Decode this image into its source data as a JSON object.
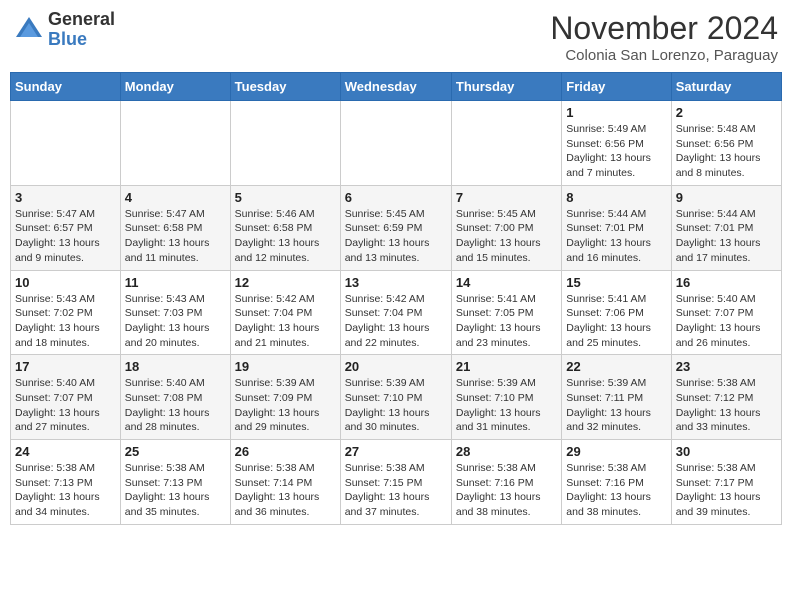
{
  "header": {
    "logo_general": "General",
    "logo_blue": "Blue",
    "month_title": "November 2024",
    "subtitle": "Colonia San Lorenzo, Paraguay"
  },
  "weekdays": [
    "Sunday",
    "Monday",
    "Tuesday",
    "Wednesday",
    "Thursday",
    "Friday",
    "Saturday"
  ],
  "weeks": [
    [
      {
        "day": "",
        "info": ""
      },
      {
        "day": "",
        "info": ""
      },
      {
        "day": "",
        "info": ""
      },
      {
        "day": "",
        "info": ""
      },
      {
        "day": "",
        "info": ""
      },
      {
        "day": "1",
        "info": "Sunrise: 5:49 AM\nSunset: 6:56 PM\nDaylight: 13 hours\nand 7 minutes."
      },
      {
        "day": "2",
        "info": "Sunrise: 5:48 AM\nSunset: 6:56 PM\nDaylight: 13 hours\nand 8 minutes."
      }
    ],
    [
      {
        "day": "3",
        "info": "Sunrise: 5:47 AM\nSunset: 6:57 PM\nDaylight: 13 hours\nand 9 minutes."
      },
      {
        "day": "4",
        "info": "Sunrise: 5:47 AM\nSunset: 6:58 PM\nDaylight: 13 hours\nand 11 minutes."
      },
      {
        "day": "5",
        "info": "Sunrise: 5:46 AM\nSunset: 6:58 PM\nDaylight: 13 hours\nand 12 minutes."
      },
      {
        "day": "6",
        "info": "Sunrise: 5:45 AM\nSunset: 6:59 PM\nDaylight: 13 hours\nand 13 minutes."
      },
      {
        "day": "7",
        "info": "Sunrise: 5:45 AM\nSunset: 7:00 PM\nDaylight: 13 hours\nand 15 minutes."
      },
      {
        "day": "8",
        "info": "Sunrise: 5:44 AM\nSunset: 7:01 PM\nDaylight: 13 hours\nand 16 minutes."
      },
      {
        "day": "9",
        "info": "Sunrise: 5:44 AM\nSunset: 7:01 PM\nDaylight: 13 hours\nand 17 minutes."
      }
    ],
    [
      {
        "day": "10",
        "info": "Sunrise: 5:43 AM\nSunset: 7:02 PM\nDaylight: 13 hours\nand 18 minutes."
      },
      {
        "day": "11",
        "info": "Sunrise: 5:43 AM\nSunset: 7:03 PM\nDaylight: 13 hours\nand 20 minutes."
      },
      {
        "day": "12",
        "info": "Sunrise: 5:42 AM\nSunset: 7:04 PM\nDaylight: 13 hours\nand 21 minutes."
      },
      {
        "day": "13",
        "info": "Sunrise: 5:42 AM\nSunset: 7:04 PM\nDaylight: 13 hours\nand 22 minutes."
      },
      {
        "day": "14",
        "info": "Sunrise: 5:41 AM\nSunset: 7:05 PM\nDaylight: 13 hours\nand 23 minutes."
      },
      {
        "day": "15",
        "info": "Sunrise: 5:41 AM\nSunset: 7:06 PM\nDaylight: 13 hours\nand 25 minutes."
      },
      {
        "day": "16",
        "info": "Sunrise: 5:40 AM\nSunset: 7:07 PM\nDaylight: 13 hours\nand 26 minutes."
      }
    ],
    [
      {
        "day": "17",
        "info": "Sunrise: 5:40 AM\nSunset: 7:07 PM\nDaylight: 13 hours\nand 27 minutes."
      },
      {
        "day": "18",
        "info": "Sunrise: 5:40 AM\nSunset: 7:08 PM\nDaylight: 13 hours\nand 28 minutes."
      },
      {
        "day": "19",
        "info": "Sunrise: 5:39 AM\nSunset: 7:09 PM\nDaylight: 13 hours\nand 29 minutes."
      },
      {
        "day": "20",
        "info": "Sunrise: 5:39 AM\nSunset: 7:10 PM\nDaylight: 13 hours\nand 30 minutes."
      },
      {
        "day": "21",
        "info": "Sunrise: 5:39 AM\nSunset: 7:10 PM\nDaylight: 13 hours\nand 31 minutes."
      },
      {
        "day": "22",
        "info": "Sunrise: 5:39 AM\nSunset: 7:11 PM\nDaylight: 13 hours\nand 32 minutes."
      },
      {
        "day": "23",
        "info": "Sunrise: 5:38 AM\nSunset: 7:12 PM\nDaylight: 13 hours\nand 33 minutes."
      }
    ],
    [
      {
        "day": "24",
        "info": "Sunrise: 5:38 AM\nSunset: 7:13 PM\nDaylight: 13 hours\nand 34 minutes."
      },
      {
        "day": "25",
        "info": "Sunrise: 5:38 AM\nSunset: 7:13 PM\nDaylight: 13 hours\nand 35 minutes."
      },
      {
        "day": "26",
        "info": "Sunrise: 5:38 AM\nSunset: 7:14 PM\nDaylight: 13 hours\nand 36 minutes."
      },
      {
        "day": "27",
        "info": "Sunrise: 5:38 AM\nSunset: 7:15 PM\nDaylight: 13 hours\nand 37 minutes."
      },
      {
        "day": "28",
        "info": "Sunrise: 5:38 AM\nSunset: 7:16 PM\nDaylight: 13 hours\nand 38 minutes."
      },
      {
        "day": "29",
        "info": "Sunrise: 5:38 AM\nSunset: 7:16 PM\nDaylight: 13 hours\nand 38 minutes."
      },
      {
        "day": "30",
        "info": "Sunrise: 5:38 AM\nSunset: 7:17 PM\nDaylight: 13 hours\nand 39 minutes."
      }
    ]
  ]
}
